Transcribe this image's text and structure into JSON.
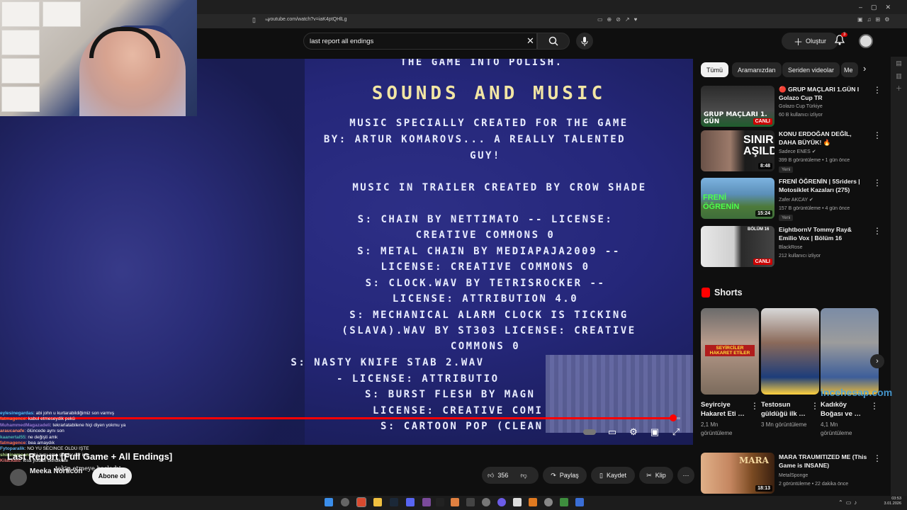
{
  "browser": {
    "url": "youtube.com/watch?v=iaK4ptQHlLg"
  },
  "header": {
    "search_query": "last report all endings",
    "create_label": "Oluştur",
    "notification_count": "3"
  },
  "video": {
    "heading": "SOUNDS AND MUSIC",
    "lines": [
      "THE GAME INTO POLISH.",
      "MUSIC SPECIALLY CREATED FOR THE GAME",
      "BY: ARTUR KOMAROVS... A REALLY TALENTED",
      "GUY!",
      "MUSIC IN TRAILER CREATED BY CROW SHADE",
      "S: CHAIN BY NETTIMATO -- LICENSE:",
      "CREATIVE COMMONS 0",
      "S: METAL CHAIN BY MEDIAPAJA2009 --",
      "LICENSE: CREATIVE COMMONS 0",
      "S: CLOCK.WAV BY TETRISROCKER --",
      "LICENSE: ATTRIBUTION 4.0",
      "S: MECHANICAL ALARM CLOCK IS TICKING",
      "(SLAVA).WAV BY ST303 LICENSE: CREATIVE",
      "COMMONS 0",
      "S: NASTY KNIFE STAB 2.WAV",
      "- LICENSE: ATTRIBUTIO",
      "S: BURST FLESH BY MAGN",
      "LICENSE: CREATIVE COMI",
      "S: CARTOON POP (CLEAN"
    ],
    "progress": 0.99,
    "title": "Last Report [Full Game + All Endings]",
    "channel": "Meeka Norticon",
    "subscribe_label": "Abone ol",
    "likes": "356",
    "share_label": "Paylaş",
    "save_label": "Kaydet",
    "clip_label": "Klip"
  },
  "chat": [
    {
      "user": "eylesinegardas",
      "msg": ": abi john u kurtarabildiğimiz son varmış",
      "color": "#4fc3f7"
    },
    {
      "user": "fatmagence",
      "msg": ": kabul etmeseydik pekü",
      "color": "#ff7043"
    },
    {
      "user": "MuhammedMagazadeli",
      "msg": ": tekrarlatabilene hiçi diyen yokmu ya",
      "color": "#9575cd"
    },
    {
      "user": "araucanafe",
      "msg": ": ölüncede aynı son",
      "color": "#ff8a65"
    },
    {
      "user": "kaanertal55",
      "msg": ": ne değişti amk",
      "color": "#4db6ac"
    },
    {
      "user": "fatmagence",
      "msg": ": bea amaydık",
      "color": "#ff7043"
    },
    {
      "user": "Fytoparalik",
      "msg": ": NO YU SECINCE ÖLDÜ İŞTE",
      "color": "#64b5f6"
    },
    {
      "user": "shiningmoon",
      "msg": ": abi aynı ama şifreler var işte",
      "color": "#aed581"
    },
    {
      "user": "Kilackato",
      "msg": ": kısa yoldan bitirdik lite",
      "color": "#e57373"
    },
    {
      "user": "",
      "msg": "takip etmeye başladı!",
      "color": "#ffffff"
    }
  ],
  "chips": [
    "Tümü",
    "Aramanızdan",
    "Seriden videolar",
    "Me"
  ],
  "recommendations": [
    {
      "title": "🔴 GRUP MAÇLARI 1.GÜN I Golazo Cup TR",
      "channel": "Golazo Cup Türkiye",
      "meta": "60 B kullanıcı izliyor",
      "badge": "CANLI",
      "thumb_text": "GRUP MAÇLARI 1. GÜN"
    },
    {
      "title": "KONU ERDOĞAN DEĞİL, DAHA BÜYÜK! 🔥",
      "channel": "Sadece ENES ✔",
      "meta": "399 B görüntüleme • 1 gün önce",
      "badge": "8:48",
      "tag": "Yeni",
      "thumb_text": "SINIR AŞILDI"
    },
    {
      "title": "FRENİ ÖĞRENİN | 5Sriders | Motosiklet Kazaları (275)",
      "channel": "Zafer AKCAY ✔",
      "meta": "157 B görüntüleme • 4 gün önce",
      "badge": "15:24",
      "tag": "Yeni",
      "thumb_text": "FRENİ ÖĞRENİN"
    },
    {
      "title": "EightbornV Tommy Ray& Emilio Vox | Bölüm 16",
      "channel": "BlackRose",
      "meta": "212 kullanıcı izliyor",
      "badge": "CANLI",
      "thumb_text": "BÖLÜM 16"
    }
  ],
  "shorts": {
    "heading": "Shorts",
    "items": [
      {
        "title": "Seyirciye Hakaret Eti …",
        "views": "2,1 Mn görüntüleme",
        "thumb_text": "SEYİRCİLER HAKARET ETİLER"
      },
      {
        "title": "Testosun güldüğü ilk …",
        "views": "3 Mn görüntüleme",
        "thumb_text": ""
      },
      {
        "title": "Kadıköy Boğası ve …",
        "views": "4,1 Mn görüntüleme",
        "thumb_text": ""
      }
    ]
  },
  "rec5": {
    "title": "MARA TRAUMITIZED ME (This Game is INSANE)",
    "channel": "MetalSponge",
    "meta": "2 görüntüleme • 22 dakika önce",
    "badge": "18:13",
    "thumb_text": "MARA"
  },
  "watermark": "incehesap.com",
  "clock": {
    "time": "03:53",
    "date": "3.01.2026"
  }
}
